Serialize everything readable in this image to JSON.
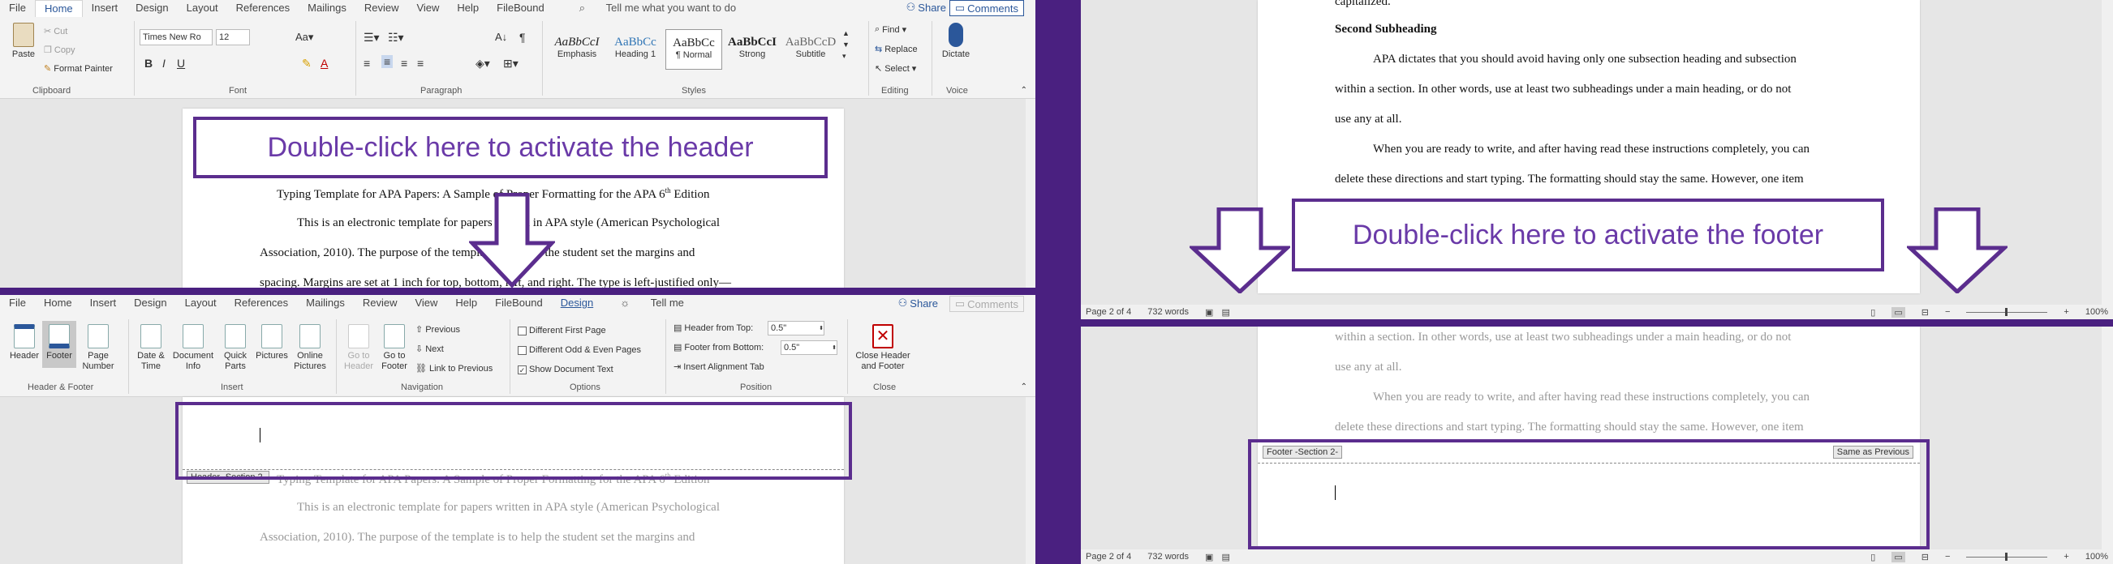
{
  "ribbon_top": {
    "tabs": [
      "File",
      "Home",
      "Insert",
      "Design",
      "Layout",
      "References",
      "Mailings",
      "Review",
      "View",
      "Help",
      "FileBound"
    ],
    "tell_me": "Tell me what you want to do",
    "share": "Share",
    "comments": "Comments",
    "clipboard": {
      "paste": "Paste",
      "cut": "Cut",
      "copy": "Copy",
      "format_painter": "Format Painter",
      "label": "Clipboard"
    },
    "font": {
      "name": "Times New Ro",
      "size": "12",
      "label": "Font"
    },
    "paragraph_label": "Paragraph",
    "styles": [
      {
        "sample": "AaBbCcI",
        "name": "Emphasis"
      },
      {
        "sample": "AaBbCc",
        "name": "Heading 1"
      },
      {
        "sample": "AaBbCc",
        "name": "¶ Normal"
      },
      {
        "sample": "AaBbCcI",
        "name": "Strong"
      },
      {
        "sample": "AaBbCcD",
        "name": "Subtitle"
      }
    ],
    "styles_label": "Styles",
    "editing": {
      "find": "Find",
      "replace": "Replace",
      "select": "Select",
      "label": "Editing"
    },
    "voice": {
      "dictate": "Dictate",
      "label": "Voice"
    }
  },
  "doc_top": {
    "title": "Typing Template for APA Papers: A Sample of Proper Formatting for the APA 6",
    "title_sup": "th",
    "title_end": " Edition",
    "lines": [
      "This is an electronic template for papers written in APA style (American Psychological",
      "Association, 2010). The purpose of the template is to help the student set the margins and",
      "spacing. Margins are set at 1 inch for top, bottom, left, and right. The type is left-justified only—"
    ]
  },
  "callout_header": "Double-click here to activate the header",
  "callout_footer": "Double-click here to activate the footer",
  "ribbon_hf": {
    "tabs": [
      "File",
      "Home",
      "Insert",
      "Design",
      "Layout",
      "References",
      "Mailings",
      "Review",
      "View",
      "Help",
      "FileBound",
      "Design",
      "Tell me"
    ],
    "share": "Share",
    "comments": "Comments",
    "header_footer": {
      "header": "Header",
      "footer": "Footer",
      "page_number": "Page Number",
      "label": "Header & Footer"
    },
    "insert": {
      "date_time": "Date & Time",
      "doc_info": "Document Info",
      "quick_parts": "Quick Parts",
      "pictures": "Pictures",
      "online_pictures": "Online Pictures",
      "label": "Insert"
    },
    "navigation": {
      "goto_header": "Go to Header",
      "goto_footer": "Go to Footer",
      "previous": "Previous",
      "next": "Next",
      "link_prev": "Link to Previous",
      "label": "Navigation"
    },
    "options": {
      "diff_first": "Different First Page",
      "diff_odd": "Different Odd & Even Pages",
      "show_doc": "Show Document Text",
      "label": "Options"
    },
    "position": {
      "header_top_label": "Header from Top:",
      "header_top_value": "0.5\"",
      "footer_bottom_label": "Footer from Bottom:",
      "footer_bottom_value": "0.5\"",
      "insert_align": "Insert Alignment Tab",
      "label": "Position"
    },
    "close": {
      "label_btn": "Close Header and Footer",
      "label": "Close"
    }
  },
  "doc_hf": {
    "header_tag": "Header -Section 2-",
    "title": "Typing Template for APA Papers: A Sample of Proper Formatting for the APA 6",
    "title_sup": "th",
    "title_end": " Edition",
    "lines": [
      "This is an electronic template for papers written in APA style (American Psychological",
      "Association, 2010). The purpose of the template is to help the student set the margins and"
    ]
  },
  "doc_right_top": {
    "line0": "capitalized.",
    "subheading": "Second Subheading",
    "lines": [
      "APA dictates that you should avoid having only one subsection heading and subsection",
      "within a section. In other words, use at least two subheadings under a main heading, or do not",
      "use any at all.",
      "When you are ready to write, and after having read these instructions completely, you can",
      "delete these directions and start typing. The formatting should stay the same. However, one item"
    ]
  },
  "doc_right_bottom": {
    "lines": [
      "within a section. In other words, use at least two subheadings under a main heading, or do not",
      "use any at all.",
      "When you are ready to write, and after having read these instructions completely, you can",
      "delete these directions and start typing. The formatting should stay the same. However, one item"
    ],
    "footer_tag": "Footer -Section 2-",
    "same_as_previous": "Same as Previous"
  },
  "status": {
    "page": "Page 2 of 4",
    "words": "732 words",
    "zoom": "100%"
  },
  "colors": {
    "accent": "#5b2d8e",
    "word_blue": "#2b579a",
    "divider": "#4a2080"
  }
}
